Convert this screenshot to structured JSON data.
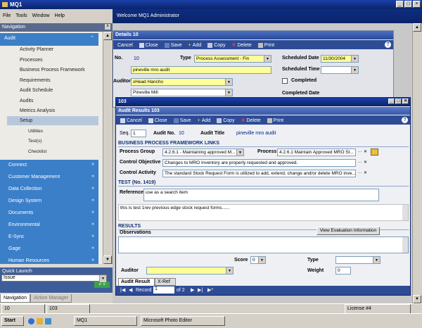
{
  "app": {
    "title": "MQ1",
    "welcome": "Welcome MQ1 Administrator",
    "menu": [
      "File",
      "Tools",
      "Window",
      "Help"
    ],
    "win_buttons": [
      "_",
      "□",
      "×"
    ]
  },
  "nav": {
    "header": "Navigation",
    "section_audit": "Audit",
    "items": [
      "Activity Planner",
      "Processes",
      "Business Process Framework",
      "Requirements",
      "Audit Schedule",
      "Audits",
      "Metrics Analysis",
      "Setup"
    ],
    "subitems": [
      "Utilities",
      "Test(s)",
      "Checklist"
    ],
    "sections": [
      "Connect",
      "Customer Management",
      "Data Collection",
      "Design System",
      "Documents",
      "Environmental",
      "E-Sync",
      "Gage",
      "Human Resources"
    ],
    "quick_launch": "Quick Launch",
    "ql_value": "Issue",
    "tabs": [
      "Navigation",
      "Action Manager"
    ]
  },
  "details": {
    "title": "Details 10",
    "toolbar": [
      "Cancel",
      "Close",
      "Save",
      "Add",
      "Copy",
      "Delete",
      "Print"
    ],
    "no_label": "No.",
    "no_value": "10",
    "type_label": "Type",
    "type_value": "Process Assessment - Fin",
    "sched_date_label": "Scheduled Date",
    "sched_date_value": "11/30/2004",
    "sched_time_label": "Scheduled Time",
    "name_value": "pineville mro audit",
    "auditor_label": "Auditor",
    "auditor_value": "xHead Hancho",
    "completed_label": "Completed",
    "site_value": "Pineville Mill",
    "completed_date_label": "Completed Date"
  },
  "results": {
    "window_title": "103",
    "title": "Audit Results 103",
    "toolbar": [
      "Cancel",
      "Close",
      "Save",
      "Add",
      "Copy",
      "Delete",
      "Print"
    ],
    "seq_label": "Seq.",
    "seq_value": "1",
    "audit_no_label": "Audit No.",
    "audit_no_value": "10",
    "audit_title_label": "Audit Title",
    "audit_title_value": "pineville mro audit",
    "bpf_header": "BUSINESS PROCESS FRAMEWORK LINKS",
    "process_group_label": "Process Group",
    "process_group_value": "4.2.6.1 - Maintaining approved M...",
    "process_label": "Process",
    "process_value": "4.2.6.1 Maintain Approved MRO St...",
    "control_objective_label": "Control Objective",
    "control_objective_value": "Changes to MRO Inventory are properly requested and approved.",
    "control_activity_label": "Control Activity",
    "control_activity_value": "The standard Stock Request Form is utilized to add, extend, change and/or delete MRO inve...",
    "test_header": "TEST (No. 1419)",
    "reference_label": "Reference",
    "reference_value": "use as a search item",
    "test_text": "this is test 1rev previous edge stock request forms......",
    "results_header": "RESULTS",
    "observations_label": "Observations",
    "view_eval_button": "View Evaluation Information",
    "score_label": "Score",
    "score_value": "0",
    "type_label": "Type",
    "auditor_label": "Auditor",
    "weight_label": "Weight",
    "weight_value": "0",
    "tabs": [
      "Audit Result",
      "X-Ref"
    ],
    "record_label": "Record",
    "record_value": "1",
    "record_of": "of 2"
  },
  "taskstrip": {
    "items": [
      "10",
      "103"
    ],
    "license": "License #4"
  },
  "taskbar": {
    "start": "Start",
    "items": [
      "MQ1",
      "Microsoft Photo Editor"
    ],
    "icons": [
      "ie-icon",
      "outlook-icon",
      "desktop-icon"
    ]
  },
  "colors": {
    "titlebar": "#0a246a",
    "nav_section": "#3a7fc8",
    "highlight": "#ffff99",
    "quick_launch": "#3e5e9a"
  }
}
